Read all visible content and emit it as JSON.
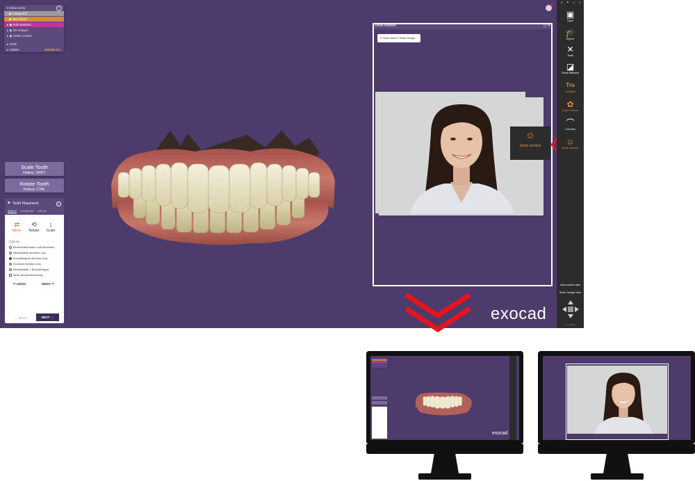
{
  "tree": {
    "rows": [
      {
        "label": "Show Hints",
        "style": ""
      },
      {
        "label": "Antagonist",
        "style": "hl1"
      },
      {
        "label": "Jaw Scans",
        "style": "hl2"
      },
      {
        "label": "Full anatomic",
        "style": "hl3"
      },
      {
        "label": "3D Images",
        "style": ""
      },
      {
        "label": "Smile Creator",
        "style": ""
      },
      {
        "label": "Teeth",
        "style": ""
      },
      {
        "label": "Hidden",
        "style": ""
      }
    ],
    "show_all": "SHOW ALL"
  },
  "tools": {
    "scale": {
      "title": "Scale Tooth",
      "hotkey": "Hotkey: SHIFT"
    },
    "rotate": {
      "title": "Rotate Tooth",
      "hotkey": "Hotkey: CTRL"
    }
  },
  "placement": {
    "title": "Tooth Placement",
    "tabs": [
      "SIMPLE",
      "ADVANCED",
      "GROUP"
    ],
    "modes": [
      {
        "label": "Move",
        "icon": "move-icon"
      },
      {
        "label": "Rotate",
        "icon": "rotate-icon"
      },
      {
        "label": "Scale",
        "icon": "scale-icon"
      }
    ],
    "options_title": "Options",
    "options": [
      "Move/scale/rotate in all directions",
      "Mesial/distal direction only",
      "Buccal/lingual direction only",
      "Occlusal direction only",
      "Mesial/distal + Buccal/lingual",
      "Move all simultaneously"
    ],
    "selected_option": 2,
    "undo": "UNDO",
    "redo": "REDO",
    "back": "BACK",
    "next": "NEXT"
  },
  "smile_window": {
    "title": "Smile window",
    "hints_button": "Show Hints in Smile Design"
  },
  "sidebar": {
    "items": [
      {
        "label": "Save",
        "icon": "save-icon",
        "color": "#ffffff"
      },
      {
        "label": "Export",
        "icon": "export-icon",
        "color": "#ffffff"
      },
      {
        "label": "Tools",
        "icon": "tools-icon",
        "color": "#ffffff"
      },
      {
        "label": "Show distance",
        "icon": "distance-icon",
        "color": "#ffffff"
      },
      {
        "label": "TruSmile",
        "icon": "trusmile-icon",
        "color": "#e58a3a"
      },
      {
        "label": "Culori Texture",
        "icon": "texture-icon",
        "color": "#e58a3a"
      },
      {
        "label": "Cut view",
        "icon": "cut-view-icon",
        "color": "#ffffff"
      },
      {
        "label": "Smile window",
        "icon": "smile-window-icon",
        "color": "#e58a3a"
      }
    ],
    "add_custom_view": "Add custom view",
    "smile_design_view": "Smile Design View",
    "version": "v3.1 Rijeka"
  },
  "tooltip": {
    "label": "Smile window"
  },
  "brand": "exocad",
  "colors": {
    "app_bg": "#4c3b6b",
    "accent": "#e58a3a",
    "arrow": "#e8141c"
  }
}
